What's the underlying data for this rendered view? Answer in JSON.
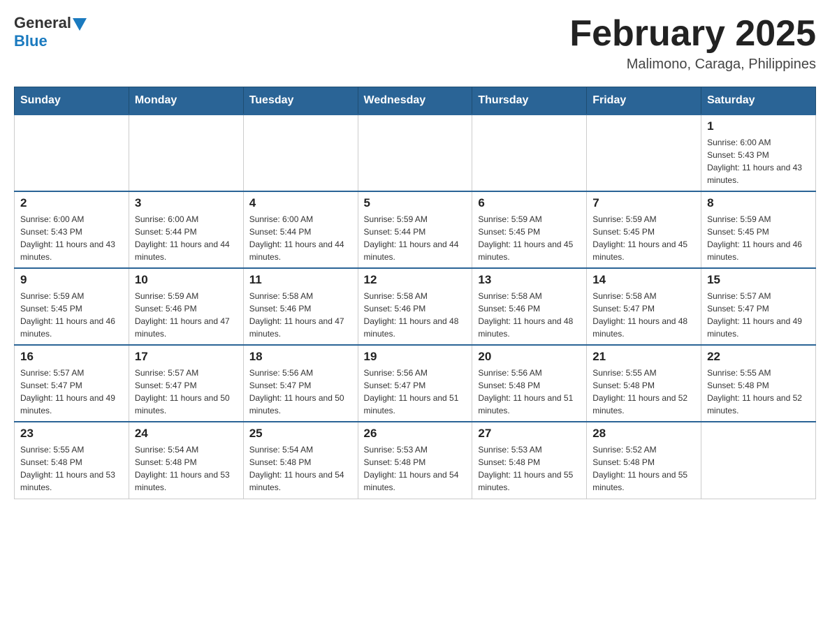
{
  "header": {
    "logo_general": "General",
    "logo_blue": "Blue",
    "month_title": "February 2025",
    "location": "Malimono, Caraga, Philippines"
  },
  "weekdays": [
    "Sunday",
    "Monday",
    "Tuesday",
    "Wednesday",
    "Thursday",
    "Friday",
    "Saturday"
  ],
  "weeks": [
    [
      {
        "day": "",
        "sunrise": "",
        "sunset": "",
        "daylight": ""
      },
      {
        "day": "",
        "sunrise": "",
        "sunset": "",
        "daylight": ""
      },
      {
        "day": "",
        "sunrise": "",
        "sunset": "",
        "daylight": ""
      },
      {
        "day": "",
        "sunrise": "",
        "sunset": "",
        "daylight": ""
      },
      {
        "day": "",
        "sunrise": "",
        "sunset": "",
        "daylight": ""
      },
      {
        "day": "",
        "sunrise": "",
        "sunset": "",
        "daylight": ""
      },
      {
        "day": "1",
        "sunrise": "Sunrise: 6:00 AM",
        "sunset": "Sunset: 5:43 PM",
        "daylight": "Daylight: 11 hours and 43 minutes."
      }
    ],
    [
      {
        "day": "2",
        "sunrise": "Sunrise: 6:00 AM",
        "sunset": "Sunset: 5:43 PM",
        "daylight": "Daylight: 11 hours and 43 minutes."
      },
      {
        "day": "3",
        "sunrise": "Sunrise: 6:00 AM",
        "sunset": "Sunset: 5:44 PM",
        "daylight": "Daylight: 11 hours and 44 minutes."
      },
      {
        "day": "4",
        "sunrise": "Sunrise: 6:00 AM",
        "sunset": "Sunset: 5:44 PM",
        "daylight": "Daylight: 11 hours and 44 minutes."
      },
      {
        "day": "5",
        "sunrise": "Sunrise: 5:59 AM",
        "sunset": "Sunset: 5:44 PM",
        "daylight": "Daylight: 11 hours and 44 minutes."
      },
      {
        "day": "6",
        "sunrise": "Sunrise: 5:59 AM",
        "sunset": "Sunset: 5:45 PM",
        "daylight": "Daylight: 11 hours and 45 minutes."
      },
      {
        "day": "7",
        "sunrise": "Sunrise: 5:59 AM",
        "sunset": "Sunset: 5:45 PM",
        "daylight": "Daylight: 11 hours and 45 minutes."
      },
      {
        "day": "8",
        "sunrise": "Sunrise: 5:59 AM",
        "sunset": "Sunset: 5:45 PM",
        "daylight": "Daylight: 11 hours and 46 minutes."
      }
    ],
    [
      {
        "day": "9",
        "sunrise": "Sunrise: 5:59 AM",
        "sunset": "Sunset: 5:45 PM",
        "daylight": "Daylight: 11 hours and 46 minutes."
      },
      {
        "day": "10",
        "sunrise": "Sunrise: 5:59 AM",
        "sunset": "Sunset: 5:46 PM",
        "daylight": "Daylight: 11 hours and 47 minutes."
      },
      {
        "day": "11",
        "sunrise": "Sunrise: 5:58 AM",
        "sunset": "Sunset: 5:46 PM",
        "daylight": "Daylight: 11 hours and 47 minutes."
      },
      {
        "day": "12",
        "sunrise": "Sunrise: 5:58 AM",
        "sunset": "Sunset: 5:46 PM",
        "daylight": "Daylight: 11 hours and 48 minutes."
      },
      {
        "day": "13",
        "sunrise": "Sunrise: 5:58 AM",
        "sunset": "Sunset: 5:46 PM",
        "daylight": "Daylight: 11 hours and 48 minutes."
      },
      {
        "day": "14",
        "sunrise": "Sunrise: 5:58 AM",
        "sunset": "Sunset: 5:47 PM",
        "daylight": "Daylight: 11 hours and 48 minutes."
      },
      {
        "day": "15",
        "sunrise": "Sunrise: 5:57 AM",
        "sunset": "Sunset: 5:47 PM",
        "daylight": "Daylight: 11 hours and 49 minutes."
      }
    ],
    [
      {
        "day": "16",
        "sunrise": "Sunrise: 5:57 AM",
        "sunset": "Sunset: 5:47 PM",
        "daylight": "Daylight: 11 hours and 49 minutes."
      },
      {
        "day": "17",
        "sunrise": "Sunrise: 5:57 AM",
        "sunset": "Sunset: 5:47 PM",
        "daylight": "Daylight: 11 hours and 50 minutes."
      },
      {
        "day": "18",
        "sunrise": "Sunrise: 5:56 AM",
        "sunset": "Sunset: 5:47 PM",
        "daylight": "Daylight: 11 hours and 50 minutes."
      },
      {
        "day": "19",
        "sunrise": "Sunrise: 5:56 AM",
        "sunset": "Sunset: 5:47 PM",
        "daylight": "Daylight: 11 hours and 51 minutes."
      },
      {
        "day": "20",
        "sunrise": "Sunrise: 5:56 AM",
        "sunset": "Sunset: 5:48 PM",
        "daylight": "Daylight: 11 hours and 51 minutes."
      },
      {
        "day": "21",
        "sunrise": "Sunrise: 5:55 AM",
        "sunset": "Sunset: 5:48 PM",
        "daylight": "Daylight: 11 hours and 52 minutes."
      },
      {
        "day": "22",
        "sunrise": "Sunrise: 5:55 AM",
        "sunset": "Sunset: 5:48 PM",
        "daylight": "Daylight: 11 hours and 52 minutes."
      }
    ],
    [
      {
        "day": "23",
        "sunrise": "Sunrise: 5:55 AM",
        "sunset": "Sunset: 5:48 PM",
        "daylight": "Daylight: 11 hours and 53 minutes."
      },
      {
        "day": "24",
        "sunrise": "Sunrise: 5:54 AM",
        "sunset": "Sunset: 5:48 PM",
        "daylight": "Daylight: 11 hours and 53 minutes."
      },
      {
        "day": "25",
        "sunrise": "Sunrise: 5:54 AM",
        "sunset": "Sunset: 5:48 PM",
        "daylight": "Daylight: 11 hours and 54 minutes."
      },
      {
        "day": "26",
        "sunrise": "Sunrise: 5:53 AM",
        "sunset": "Sunset: 5:48 PM",
        "daylight": "Daylight: 11 hours and 54 minutes."
      },
      {
        "day": "27",
        "sunrise": "Sunrise: 5:53 AM",
        "sunset": "Sunset: 5:48 PM",
        "daylight": "Daylight: 11 hours and 55 minutes."
      },
      {
        "day": "28",
        "sunrise": "Sunrise: 5:52 AM",
        "sunset": "Sunset: 5:48 PM",
        "daylight": "Daylight: 11 hours and 55 minutes."
      },
      {
        "day": "",
        "sunrise": "",
        "sunset": "",
        "daylight": ""
      }
    ]
  ]
}
